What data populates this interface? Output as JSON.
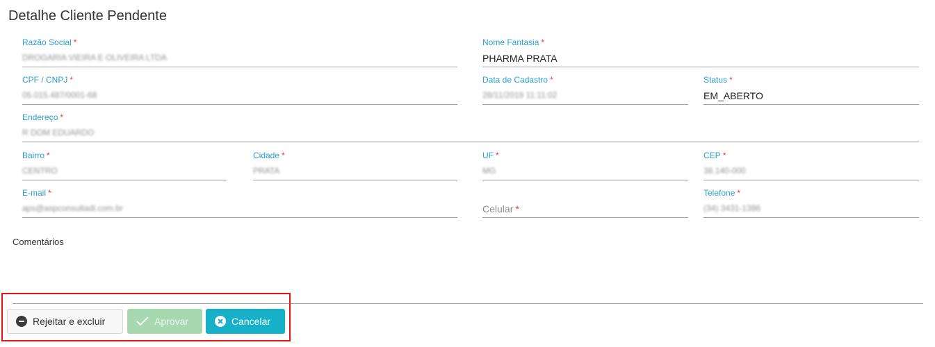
{
  "page": {
    "title": "Detalhe Cliente Pendente"
  },
  "fields": {
    "razao_social": {
      "label": "Razão Social",
      "required": "*",
      "value": "DROGARIA VIEIRA E OLIVEIRA LTDA"
    },
    "nome_fantasia": {
      "label": "Nome Fantasia",
      "required": "*",
      "value": "PHARMA PRATA"
    },
    "cpf_cnpj": {
      "label": "CPF / CNPJ",
      "required": "*",
      "value": "05.015.487/0001-68"
    },
    "data_cadastro": {
      "label": "Data de Cadastro",
      "required": "*",
      "value": "28/11/2019 11:11:02"
    },
    "status": {
      "label": "Status",
      "required": "*",
      "value": "EM_ABERTO"
    },
    "endereco": {
      "label": "Endereço",
      "required": "*",
      "value": "R DOM EDUARDO"
    },
    "bairro": {
      "label": "Bairro",
      "required": "*",
      "value": "CENTRO"
    },
    "cidade": {
      "label": "Cidade",
      "required": "*",
      "value": "PRATA"
    },
    "uf": {
      "label": "UF",
      "required": "*",
      "value": "MG"
    },
    "cep": {
      "label": "CEP",
      "required": "*",
      "value": "38.140-000"
    },
    "email": {
      "label": "E-mail",
      "required": "*",
      "value": "aps@aspconsultadl.com.br"
    },
    "celular": {
      "placeholder": "Celular",
      "required": "*"
    },
    "telefone": {
      "label": "Telefone",
      "required": "*",
      "value": "(34) 3431-1386"
    }
  },
  "comments": {
    "label": "Comentários"
  },
  "actions": {
    "reject_label": "Rejeitar e excluir",
    "approve_label": "Aprovar",
    "cancel_label": "Cancelar"
  },
  "colors": {
    "label_blue": "#2a9fd6",
    "required_red": "#e53935",
    "approve_green_disabled": "#a7d8b0",
    "cancel_teal": "#17b0c9",
    "highlight_red": "#e81212"
  }
}
